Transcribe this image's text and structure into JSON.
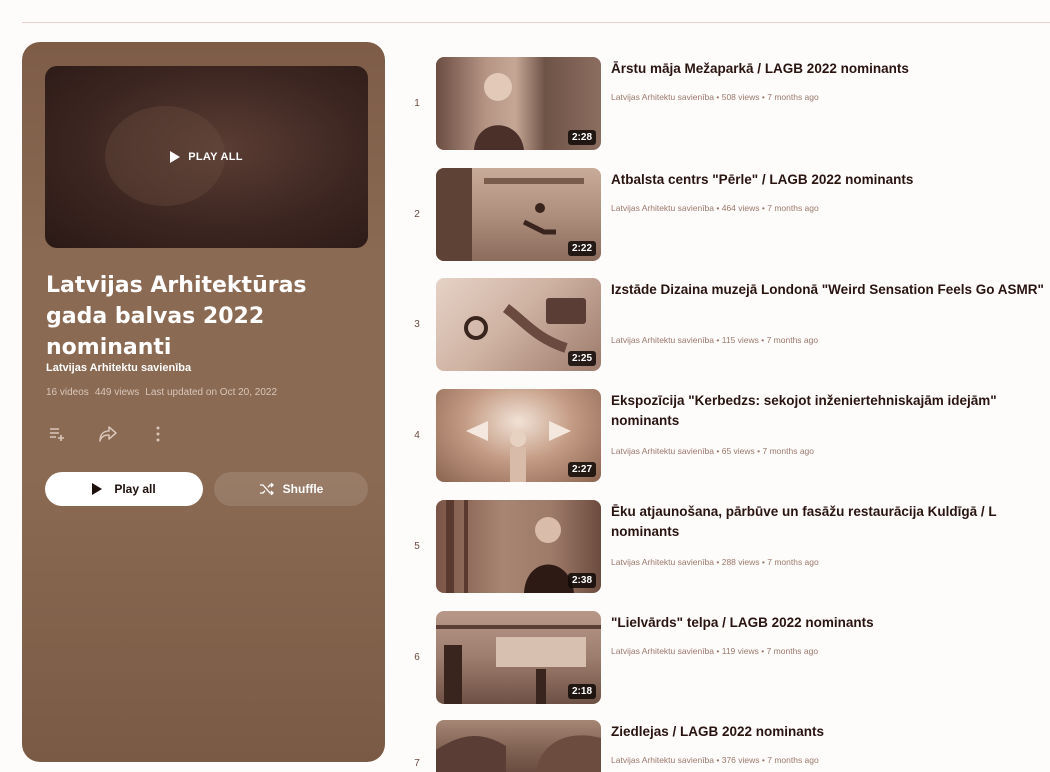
{
  "playlist": {
    "hero_label": "PLAY ALL",
    "title": "Latvijas Arhitektūras gada balvas 2022 nominanti",
    "owner": "Latvijas Arhitektu savienība",
    "stats": {
      "videos": "16 videos",
      "views": "449 views",
      "updated": "Last updated on Oct 20, 2022"
    },
    "buttons": {
      "play_all": "Play all",
      "shuffle": "Shuffle"
    }
  },
  "videos": [
    {
      "index": "1",
      "title": "Ārstu māja Mežaparkā / LAGB 2022 nominants",
      "channel": "Latvijas Arhitektu savienība",
      "views": "508 views",
      "age": "7 months ago",
      "duration": "2:28"
    },
    {
      "index": "2",
      "title": "Atbalsta centrs \"Pērle\" / LAGB 2022 nominants",
      "channel": "Latvijas Arhitektu savienība",
      "views": "464 views",
      "age": "7 months ago",
      "duration": "2:22"
    },
    {
      "index": "3",
      "title": "Izstāde Dizaina muzejā Londonā \"Weird Sensation Feels Go ASMR\"",
      "channel": "Latvijas Arhitektu savienība",
      "views": "115 views",
      "age": "7 months ago",
      "duration": "2:25"
    },
    {
      "index": "4",
      "title": "Ekspozīcija \"Kerbedzs: sekojot inženiertehniskajām idejām\" nominants",
      "channel": "Latvijas Arhitektu savienība",
      "views": "65 views",
      "age": "7 months ago",
      "duration": "2:27"
    },
    {
      "index": "5",
      "title": "Ēku atjaunošana, pārbūve un fasāžu restaurācija Kuldīgā / L nominants",
      "channel": "Latvijas Arhitektu savienība",
      "views": "288 views",
      "age": "7 months ago",
      "duration": "2:38"
    },
    {
      "index": "6",
      "title": "\"Lielvārds\" telpa / LAGB 2022 nominants",
      "channel": "Latvijas Arhitektu savienība",
      "views": "119 views",
      "age": "7 months ago",
      "duration": "2:18"
    },
    {
      "index": "7",
      "title": "Ziedlejas / LAGB 2022 nominants",
      "channel": "Latvijas Arhitektu savienība",
      "views": "376 views",
      "age": "7 months ago",
      "duration": ""
    }
  ]
}
